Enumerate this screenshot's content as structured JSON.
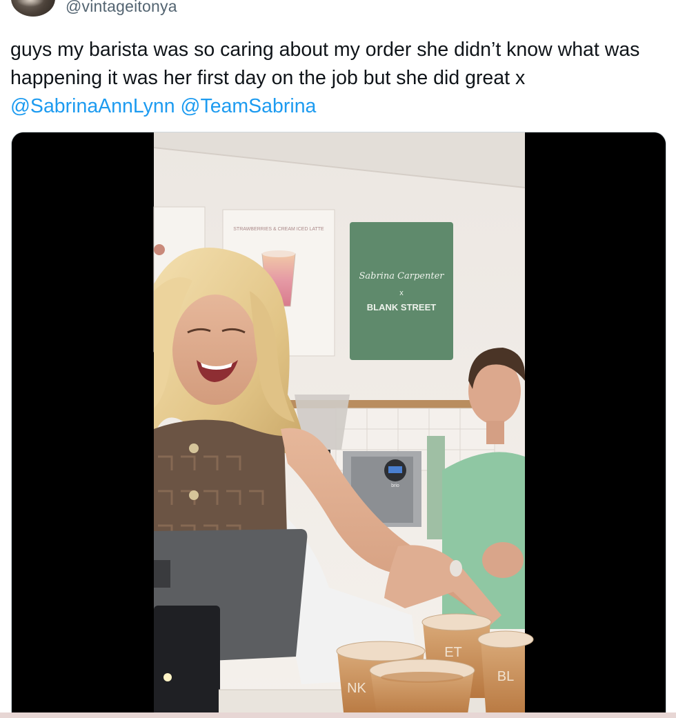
{
  "tweet": {
    "handle": "@vintageitonya",
    "text_line1": "guys my barista was so caring about my order she didn’t know what was",
    "text_line2": "happening it was her first day on the job  but she did great x",
    "mention1": "@SabrinaAnnLynn",
    "mention2": "@TeamSabrina"
  },
  "media": {
    "menu_board_title": "STRAWBERRIES & CREAM ICED LATTE",
    "sign_line1": "Sabrina Carpenter",
    "sign_line2": "x",
    "sign_line3": "BLANK STREET",
    "cup_text1": "ET",
    "cup_text2": "NK",
    "cup_text3": "BL",
    "machine_brand": "brio"
  },
  "colors": {
    "link": "#1d9bf0",
    "text": "#0f1419",
    "secondary": "#536471",
    "sign_green": "#5f8a6c"
  }
}
